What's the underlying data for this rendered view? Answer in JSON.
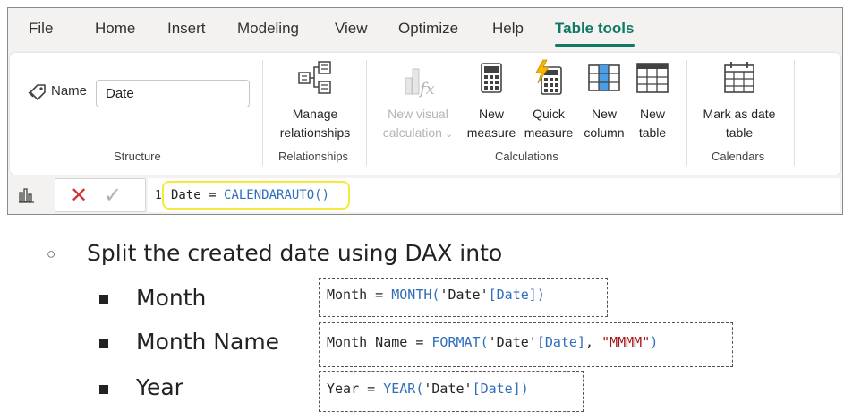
{
  "menu": {
    "items": [
      "File",
      "Home",
      "Insert",
      "Modeling",
      "View",
      "Optimize",
      "Help",
      "Table tools"
    ],
    "active": "Table tools"
  },
  "ribbon": {
    "structure": {
      "name_label": "Name",
      "name_value": "Date",
      "group_label": "Structure"
    },
    "relationships": {
      "manage_label_1": "Manage",
      "manage_label_2": "relationships",
      "group_label": "Relationships"
    },
    "calculations": {
      "new_visual_1": "New visual",
      "new_visual_2": "calculation",
      "new_measure_1": "New",
      "new_measure_2": "measure",
      "quick_measure_1": "Quick",
      "quick_measure_2": "measure",
      "new_column_1": "New",
      "new_column_2": "column",
      "new_table_1": "New",
      "new_table_2": "table",
      "group_label": "Calculations"
    },
    "calendars": {
      "mark_date_1": "Mark as date",
      "mark_date_2": "table",
      "group_label": "Calendars"
    }
  },
  "formula_bar": {
    "line_number": "1",
    "code_name": "Date",
    "code_eq": " = ",
    "code_fn": "CALENDARAUTO()"
  },
  "slide": {
    "intro": "Split the created date using DAX into",
    "items": [
      {
        "label": "Month",
        "code": {
          "name": "Month",
          "eq": " = ",
          "fn": "MONTH(",
          "tbl": "'Date'",
          "col": "[Date]",
          "close": ")"
        }
      },
      {
        "label": "Month Name",
        "code": {
          "name": "Month Name",
          "eq": " = ",
          "fn": "FORMAT(",
          "tbl": "'Date'",
          "col": "[Date]",
          "sep": ", ",
          "fmt": "\"MMMM\"",
          "close": ")"
        }
      },
      {
        "label": "Year",
        "code": {
          "name": "Year",
          "eq": " = ",
          "fn": "YEAR(",
          "tbl": "'Date'",
          "col": "[Date]",
          "close": ")"
        }
      }
    ]
  },
  "colors": {
    "accent": "#117865",
    "dax_function": "#2f6eba",
    "dax_string": "#a31515",
    "cancel_red": "#d13438",
    "highlight": "#f5ea3a"
  }
}
